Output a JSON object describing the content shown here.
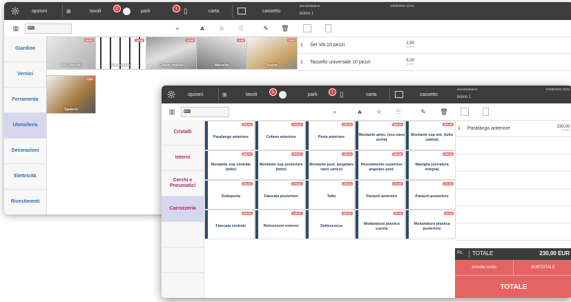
{
  "nav": {
    "opzioni": "opzioni",
    "tavoli": "tavoli",
    "tavoli_badge": "11",
    "park": "park",
    "park_badge": "1",
    "carta": "carta",
    "cassetto": "cassetto"
  },
  "header": {
    "user": "amministratore",
    "datetime": "04/06/2021 10:51",
    "listino": "listino 1"
  },
  "back": {
    "categories": [
      "Giardino",
      "Vernici",
      "Ferramenta",
      "Utensileria",
      "Decorazioni",
      "Elettricità",
      "Rivestimenti"
    ],
    "active": "Utensileria",
    "tiles": [
      {
        "label": "Set Utensili",
        "price": "38,00"
      },
      {
        "label": "Cacciavite",
        "price": "12,99"
      },
      {
        "label": "Chiavi Inglesi",
        "price": "23,50"
      },
      {
        "label": "Martello",
        "price": "9,90"
      },
      {
        "label": "Seghe",
        "price": "5,90"
      },
      {
        "label": "Spatole",
        "price": "1,90"
      }
    ],
    "order": [
      {
        "qty": "1",
        "desc": "Set Viti 10 pezzi",
        "price": "2,50",
        "vat": "10,00%"
      },
      {
        "qty": "1",
        "desc": "Tassello universale 10 pezzi",
        "price": "5,00",
        "vat": "10,00%"
      }
    ]
  },
  "front": {
    "categories": [
      "Cristalli",
      "Interni",
      "Cerchi e Pneumatici",
      "Carrozzeria"
    ],
    "active": "Carrozzeria",
    "products": [
      {
        "label": "Parafango anteriore",
        "price": "230,00"
      },
      {
        "label": "Cofano anteriore",
        "price": "250,00"
      },
      {
        "label": "Porta anteriore",
        "price": "250,00"
      },
      {
        "label": "Montante anter. (oss.vano porta)",
        "price": "300,00"
      },
      {
        "label": "Montante sup ant. (tetto cabina)",
        "price": "300,00"
      },
      {
        "label": "Monatnte sup centrale (tetto)",
        "price": "300,00"
      },
      {
        "label": "Montante sup posteriore (tetto)",
        "price": "300,00"
      },
      {
        "label": "Montante post. (angolare vano carico)",
        "price": "300,00"
      },
      {
        "label": "Rivestimento superiore angolare post.",
        "price": "300,00"
      },
      {
        "label": "Maniglia (serratura integra)",
        "price": "120,00"
      },
      {
        "label": "Sottoporta",
        "price": "150,00"
      },
      {
        "label": "Fiancata posteriore",
        "price": "470,00"
      },
      {
        "label": "Tetto",
        "price": "450,00"
      },
      {
        "label": "Paraurti anteriore",
        "price": "170,00"
      },
      {
        "label": "Paraurti posteriore",
        "price": "170,00"
      },
      {
        "label": "Fiancata centrale",
        "price": "250,00"
      },
      {
        "label": "Retrovisore esterno",
        "price": "120,00"
      },
      {
        "label": "Sottoscocca",
        "price": "500,00"
      },
      {
        "label": "Modanatura plastica v.porta",
        "price": "60,00"
      },
      {
        "label": "Modanatura plastica posteriore",
        "price": "60,00"
      }
    ],
    "order": [
      {
        "qty": "1",
        "desc": "Parafango anteriore",
        "price": "230,00",
        "vat": "10,00%"
      }
    ],
    "totals": {
      "pz": "Pz.",
      "label": "TOTALE",
      "amount": "230,00 EUR",
      "annulla": "annulla conto",
      "subtotale": "SUBTOTALE",
      "totale_btn": "TOTALE"
    }
  },
  "colors": {
    "topbar": "#3c3c3c",
    "accent_blue": "#2a6db2",
    "active_tab": "#d6d6ee",
    "red_btn": "#e66363"
  }
}
